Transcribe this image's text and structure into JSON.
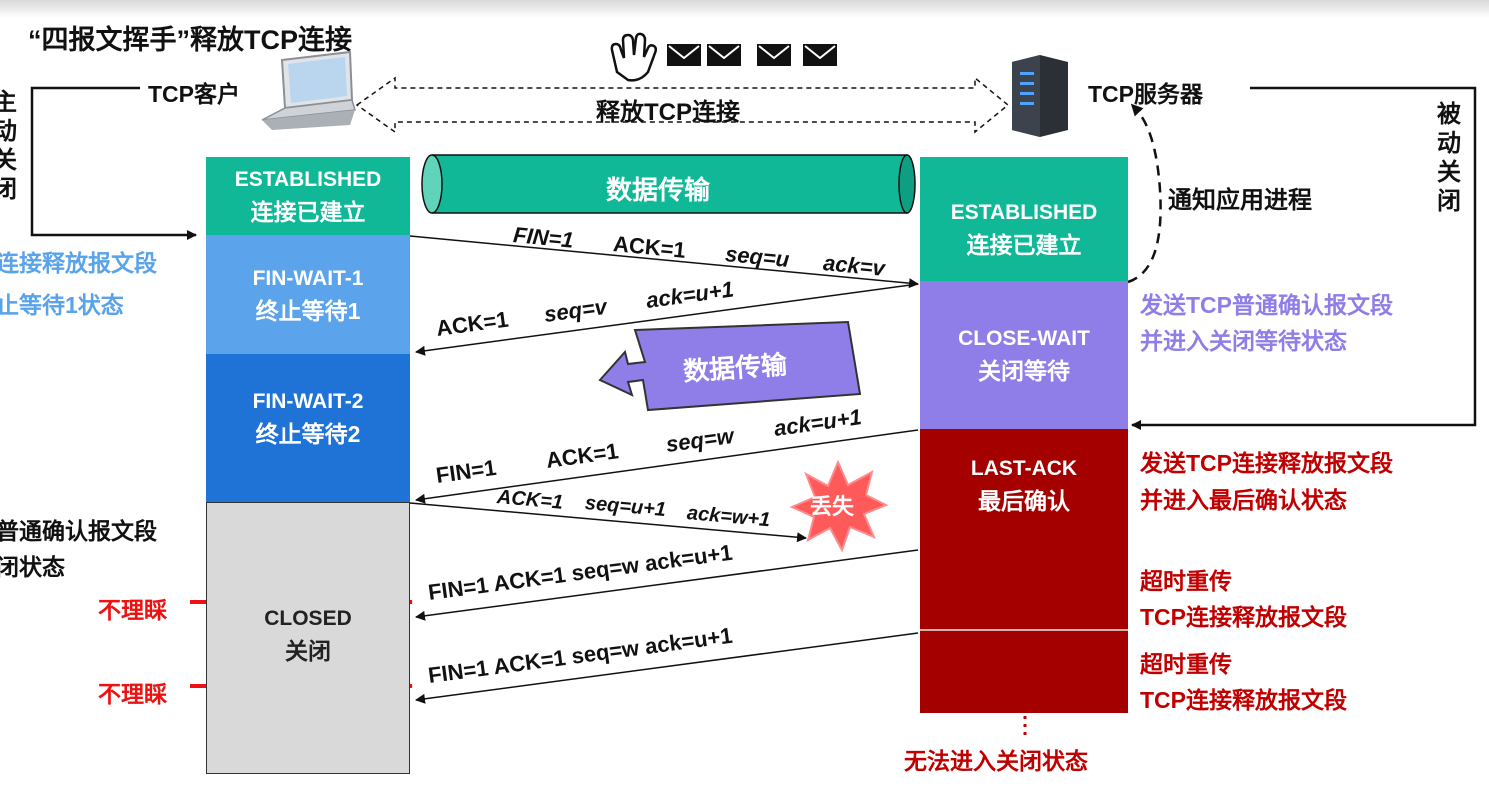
{
  "title": "“四报文挥手”释放TCP连接",
  "client_label": "TCP客户",
  "server_label": "TCP服务器",
  "release_label": "释放TCP连接",
  "client_active_close": "主动关闭",
  "server_passive_close": "被动关闭",
  "notify_app": "通知应用进程",
  "client_states": [
    {
      "en": "ESTABLISHED",
      "cn": "连接已建立"
    },
    {
      "en": "FIN-WAIT-1",
      "cn": "终止等待1"
    },
    {
      "en": "FIN-WAIT-2",
      "cn": "终止等待2"
    },
    {
      "en": "CLOSED",
      "cn": "关闭"
    }
  ],
  "server_states": [
    {
      "en": "ESTABLISHED",
      "cn": "连接已建立"
    },
    {
      "en": "CLOSE-WAIT",
      "cn": "关闭等待"
    },
    {
      "en": "LAST-ACK",
      "cn": "最后确认"
    }
  ],
  "data_transfer_1": "数据传输",
  "data_transfer_2": "数据传输",
  "left_notes": {
    "fin_wait1_line1": "连接释放报文段",
    "fin_wait1_line2": "止等待1状态",
    "closed_line1": "普通确认报文段",
    "closed_line2": "闭状态"
  },
  "right_notes": {
    "close_wait_line1": "发送TCP普通确认报文段",
    "close_wait_line2": "并进入关闭等待状态",
    "last_ack_line1": "发送TCP连接释放报文段",
    "last_ack_line2": "并进入最后确认状态",
    "retrans1_line1": "超时重传",
    "retrans1_line2": "TCP连接释放报文段",
    "retrans2_line1": "超时重传",
    "retrans2_line2": "TCP连接释放报文段",
    "ellipsis": "⋮",
    "cannot_close": "无法进入关闭状态"
  },
  "segments": {
    "s1": {
      "fin": "FIN=1",
      "ack": "ACK=1",
      "seq": "seq=u",
      "acknum": "ack=v"
    },
    "s2": {
      "ack": "ACK=1",
      "seq": "seq=v",
      "acknum": "ack=u+1"
    },
    "s3": {
      "fin": "FIN=1",
      "ack": "ACK=1",
      "seq": "seq=w",
      "acknum": "ack=u+1"
    },
    "s4": {
      "ack": "ACK=1",
      "seq": "seq=u+1",
      "acknum": "ack=w+1"
    },
    "s5": "FIN=1 ACK=1 seq=w ack=u+1",
    "s6": "FIN=1 ACK=1 seq=w ack=u+1"
  },
  "lost_label": "丢失",
  "ignore_1": "不理睬",
  "ignore_2": "不理睬",
  "colors": {
    "teal": "#10b897",
    "blue": "#5ba3ea",
    "dark_blue": "#1f72d6",
    "gray": "#d9d9d9",
    "purple": "#8f7de8",
    "dark_red": "#a40000",
    "red_text": "#c00000",
    "bright_red": "#ee1111"
  }
}
